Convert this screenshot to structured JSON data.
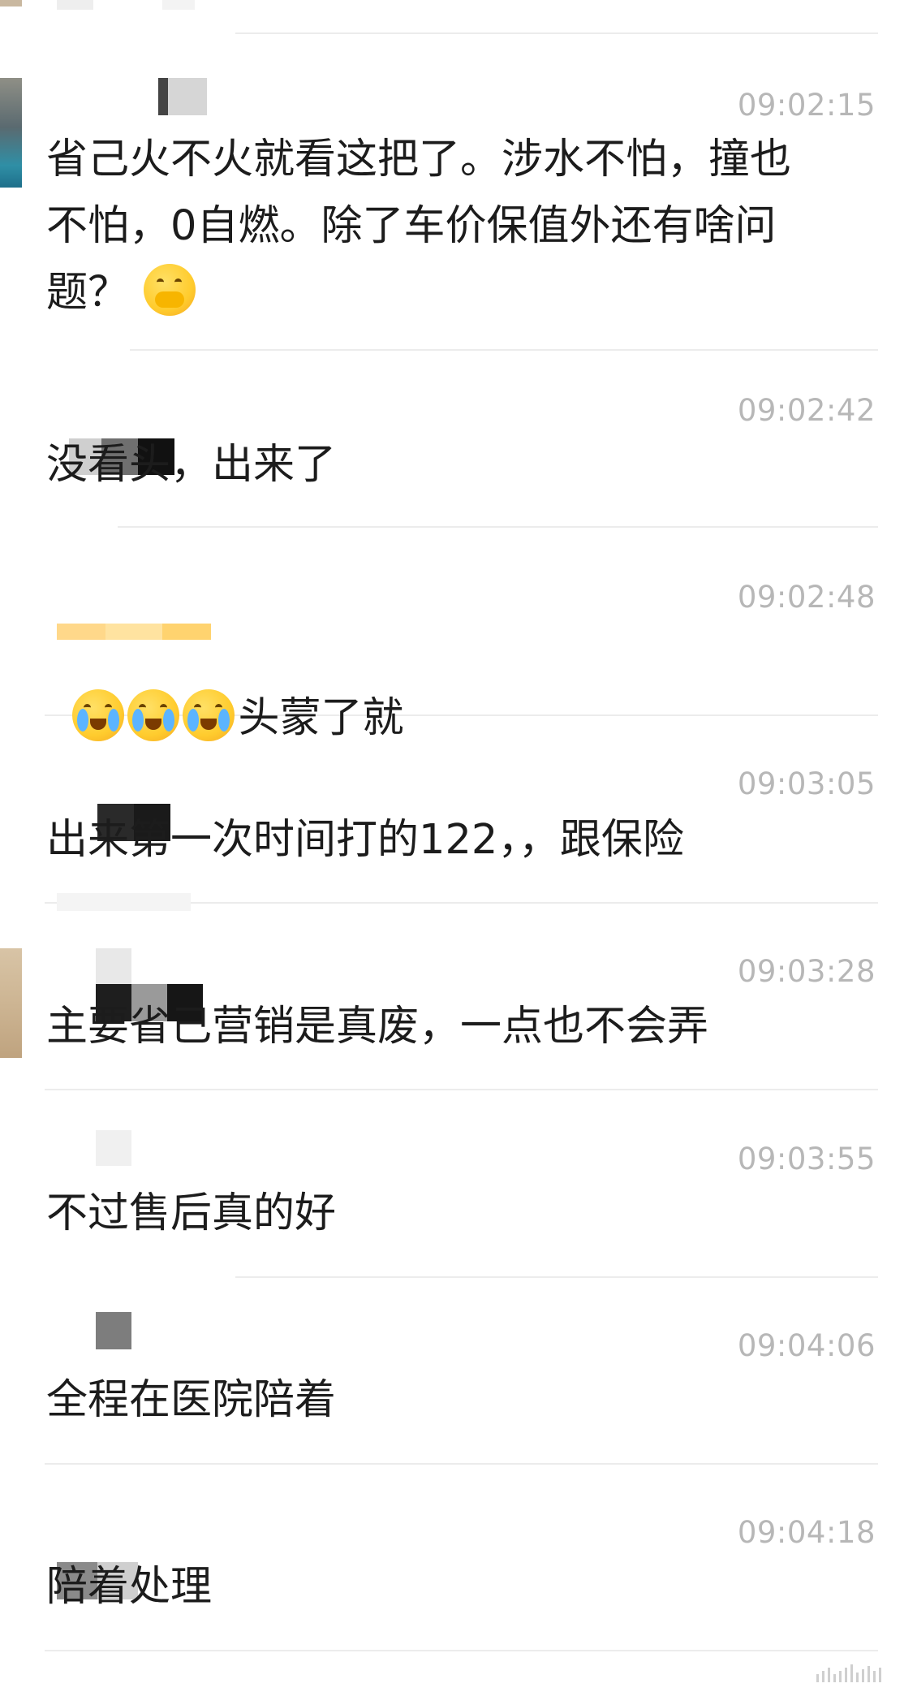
{
  "messages": [
    {
      "time": "09:02:15",
      "text": "省己火不火就看这把了。涉水不怕，撞也\n不怕，0自燃。除了车价保值外还有啥问\n题？",
      "emoji": "thinking-face"
    },
    {
      "time": "09:02:42",
      "text": "没看头，出来了"
    },
    {
      "time": "09:02:48",
      "text": "头蒙了就",
      "emoji_prefix": [
        "crying-face",
        "crying-face",
        "crying-face"
      ]
    },
    {
      "time": "09:03:05",
      "text": "出来第一次时间打的122，，跟保险"
    },
    {
      "time": "09:03:28",
      "text": "主要省己营销是真废，一点也不会弄"
    },
    {
      "time": "09:03:55",
      "text": "不过售后真的好"
    },
    {
      "time": "09:04:06",
      "text": "全程在医院陪着"
    },
    {
      "time": "09:04:18",
      "text": "陪着处理"
    }
  ],
  "colors": {
    "text": "#1c1c1c",
    "timestamp": "#b7b7b7",
    "divider": "#ececec",
    "background": "#ffffff"
  }
}
